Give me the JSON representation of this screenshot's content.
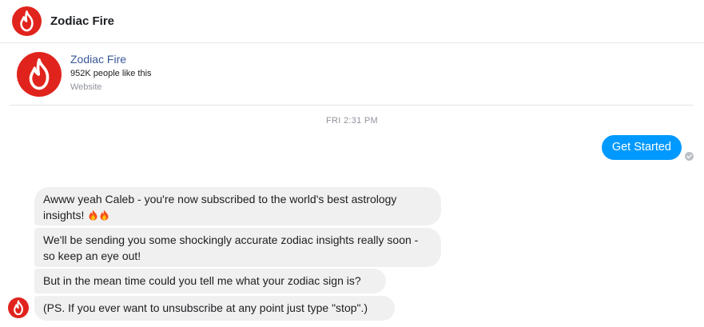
{
  "header": {
    "title": "Zodiac Fire",
    "avatar_icon": "fire-icon"
  },
  "page_info": {
    "name": "Zodiac Fire",
    "likes": "952K people like this",
    "category": "Website",
    "avatar_icon": "fire-icon"
  },
  "conversation": {
    "timestamp": "FRI 2:31 PM",
    "outgoing": [
      {
        "text": "Get Started",
        "status_icon": "seen-check-icon"
      }
    ],
    "incoming": [
      {
        "text": "Awww yeah Caleb - you're now subscribed to the world's best astrology insights!",
        "emoji": [
          "fire-emoji",
          "fire-emoji"
        ]
      },
      {
        "text": "We'll be sending you some shockingly accurate zodiac insights really soon - so keep an eye out!"
      },
      {
        "text": "But in the mean time could you tell me what your zodiac sign is?"
      },
      {
        "text": "(PS. If you ever want to unsubscribe at any point just type \"stop\".)"
      }
    ]
  },
  "colors": {
    "brand_red": "#e0241d",
    "messenger_blue": "#0099ff",
    "incoming_bubble": "#f1f0f0",
    "link_blue": "#385898",
    "muted_gray": "#90949c"
  }
}
